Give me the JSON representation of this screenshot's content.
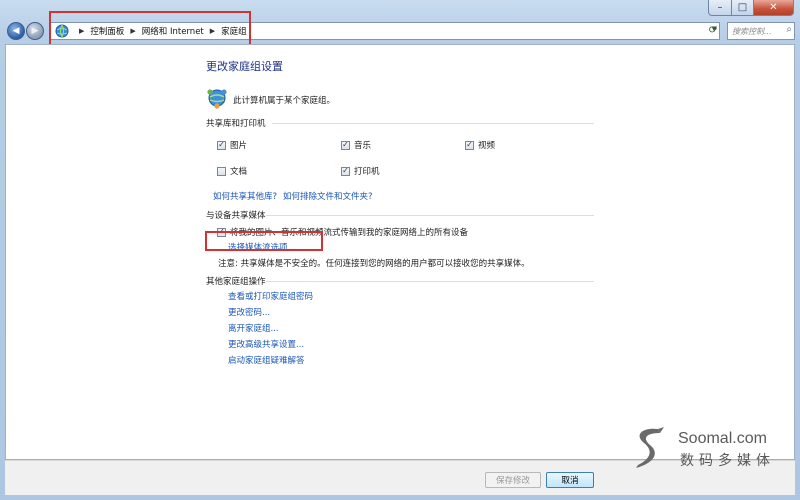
{
  "window": {
    "controls": {
      "minimize": "–",
      "maximize": "□",
      "close": "✕"
    }
  },
  "nav": {
    "back_icon": "arrow-left-icon",
    "forward_icon": "arrow-right-icon",
    "breadcrumbs": [
      "控制面板",
      "网络和 Internet",
      "家庭组"
    ],
    "search_placeholder": "搜索控制..."
  },
  "page": {
    "title": "更改家庭组设置",
    "homegroup_status": "此计算机属于某个家庭组。"
  },
  "sharing": {
    "header": "共享库和打印机",
    "items": [
      {
        "label": "图片",
        "checked": true
      },
      {
        "label": "音乐",
        "checked": true
      },
      {
        "label": "视频",
        "checked": true
      },
      {
        "label": "文档",
        "checked": false
      },
      {
        "label": "打印机",
        "checked": true
      }
    ],
    "links": [
      "如何共享其他库?",
      "如何排除文件和文件夹?"
    ]
  },
  "media": {
    "header": "与设备共享媒体",
    "stream_label": "将我的图片、音乐和视频流式传输到我的家庭网络上的所有设备",
    "stream_checked": true,
    "options_link": "选择媒体流选项...",
    "note": "注意: 共享媒体是不安全的。任何连接到您的网络的用户都可以接收您的共享媒体。"
  },
  "other": {
    "header": "其他家庭组操作",
    "links": [
      "查看或打印家庭组密码",
      "更改密码...",
      "离开家庭组...",
      "更改高级共享设置...",
      "启动家庭组疑难解答"
    ]
  },
  "buttons": {
    "save": "保存修改",
    "cancel": "取消"
  },
  "watermark": {
    "brand_en": "Soomal.com",
    "brand_cn": "数码多媒体"
  },
  "colors": {
    "title": "#1e3287",
    "link": "#1a56b8",
    "highlight": "#d23232"
  }
}
